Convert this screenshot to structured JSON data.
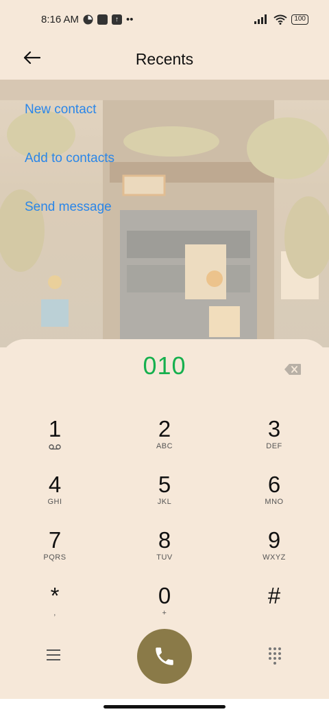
{
  "status_bar": {
    "time": "8:16 AM",
    "battery": "100",
    "overflow": "••"
  },
  "header": {
    "title": "Recents"
  },
  "actions": [
    {
      "label": "New contact"
    },
    {
      "label": "Add to contacts"
    },
    {
      "label": "Send message"
    }
  ],
  "dialer": {
    "number": "010",
    "keys": [
      {
        "digit": "1",
        "letters": ""
      },
      {
        "digit": "2",
        "letters": "ABC"
      },
      {
        "digit": "3",
        "letters": "DEF"
      },
      {
        "digit": "4",
        "letters": "GHI"
      },
      {
        "digit": "5",
        "letters": "JKL"
      },
      {
        "digit": "6",
        "letters": "MNO"
      },
      {
        "digit": "7",
        "letters": "PQRS"
      },
      {
        "digit": "8",
        "letters": "TUV"
      },
      {
        "digit": "9",
        "letters": "WXYZ"
      },
      {
        "digit": "*",
        "letters": ","
      },
      {
        "digit": "0",
        "letters": "+"
      },
      {
        "digit": "#",
        "letters": ""
      }
    ]
  },
  "colors": {
    "background": "#f6e8d9",
    "link": "#2a86e8",
    "number": "#16b04e",
    "call_button": "#8a7a48"
  },
  "icons": {
    "back": "arrow-left-icon",
    "backspace": "backspace-icon",
    "voicemail": "voicemail-icon",
    "menu": "menu-icon",
    "call": "phone-icon",
    "dialpad": "dialpad-icon"
  }
}
